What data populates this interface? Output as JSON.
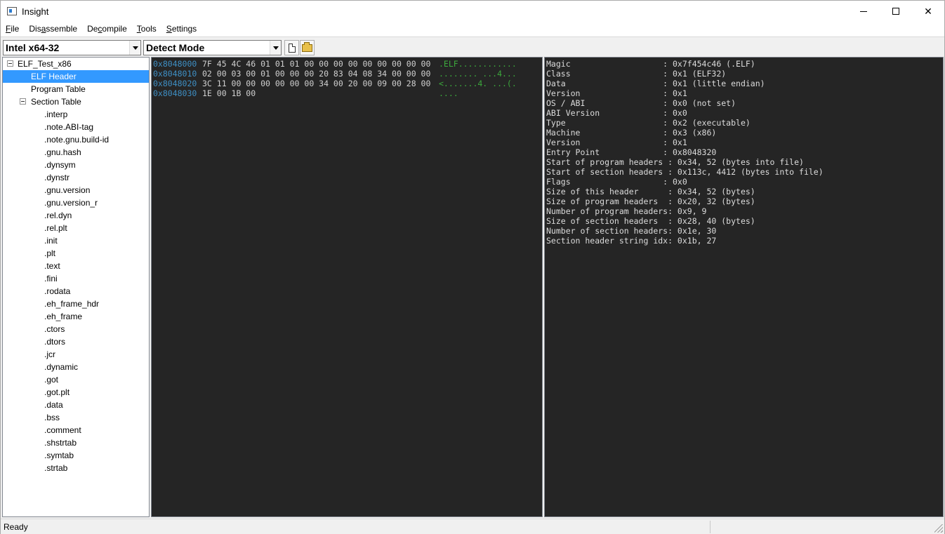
{
  "window": {
    "title": "Insight",
    "icon": "app-icon"
  },
  "menu": [
    "File",
    "Disassemble",
    "Decompile",
    "Tools",
    "Settings"
  ],
  "menu_underline_index": [
    0,
    3,
    2,
    0,
    0
  ],
  "toolbar": {
    "architecture": "Intel x64-32",
    "mode": "Detect Mode",
    "new_icon": "new-file-icon",
    "open_icon": "open-folder-icon"
  },
  "tree": {
    "root": "ELF_Test_x86",
    "elf_header": "ELF Header",
    "program_table": "Program Table",
    "section_table": "Section Table",
    "sections": [
      ".interp",
      ".note.ABI-tag",
      ".note.gnu.build-id",
      ".gnu.hash",
      ".dynsym",
      ".dynstr",
      ".gnu.version",
      ".gnu.version_r",
      ".rel.dyn",
      ".rel.plt",
      ".init",
      ".plt",
      ".text",
      ".fini",
      ".rodata",
      ".eh_frame_hdr",
      ".eh_frame",
      ".ctors",
      ".dtors",
      ".jcr",
      ".dynamic",
      ".got",
      ".got.plt",
      ".data",
      ".bss",
      ".comment",
      ".shstrtab",
      ".symtab",
      ".strtab"
    ]
  },
  "hex": [
    {
      "addr": "0x8048000",
      "bytes": "7F 45 4C 46 01 01 01 00 00 00 00 00 00 00 00 00",
      "ascii": ".ELF............"
    },
    {
      "addr": "0x8048010",
      "bytes": "02 00 03 00 01 00 00 00 20 83 04 08 34 00 00 00",
      "ascii": "........ ...4..."
    },
    {
      "addr": "0x8048020",
      "bytes": "3C 11 00 00 00 00 00 00 34 00 20 00 09 00 28 00",
      "ascii": "<.......4. ...(."
    },
    {
      "addr": "0x8048030",
      "bytes": "1E 00 1B 00",
      "ascii": "...."
    }
  ],
  "header_info": [
    "Magic                   : 0x7f454c46 (.ELF)",
    "Class                   : 0x1 (ELF32)",
    "Data                    : 0x1 (little endian)",
    "Version                 : 0x1",
    "OS / ABI                : 0x0 (not set)",
    "ABI Version             : 0x0",
    "Type                    : 0x2 (executable)",
    "Machine                 : 0x3 (x86)",
    "Version                 : 0x1",
    "Entry Point             : 0x8048320",
    "Start of program headers : 0x34, 52 (bytes into file)",
    "Start of section headers : 0x113c, 4412 (bytes into file)",
    "Flags                   : 0x0",
    "Size of this header      : 0x34, 52 (bytes)",
    "Size of program headers  : 0x20, 32 (bytes)",
    "Number of program headers: 0x9, 9",
    "Size of section headers  : 0x28, 40 (bytes)",
    "Number of section headers: 0x1e, 30",
    "Section header string idx: 0x1b, 27"
  ],
  "status": {
    "text": "Ready"
  },
  "colors": {
    "selection": "#3399ff",
    "hex_addr": "#3e8fc4",
    "hex_ascii": "#3ca83c",
    "panel_bg": "#252525"
  }
}
